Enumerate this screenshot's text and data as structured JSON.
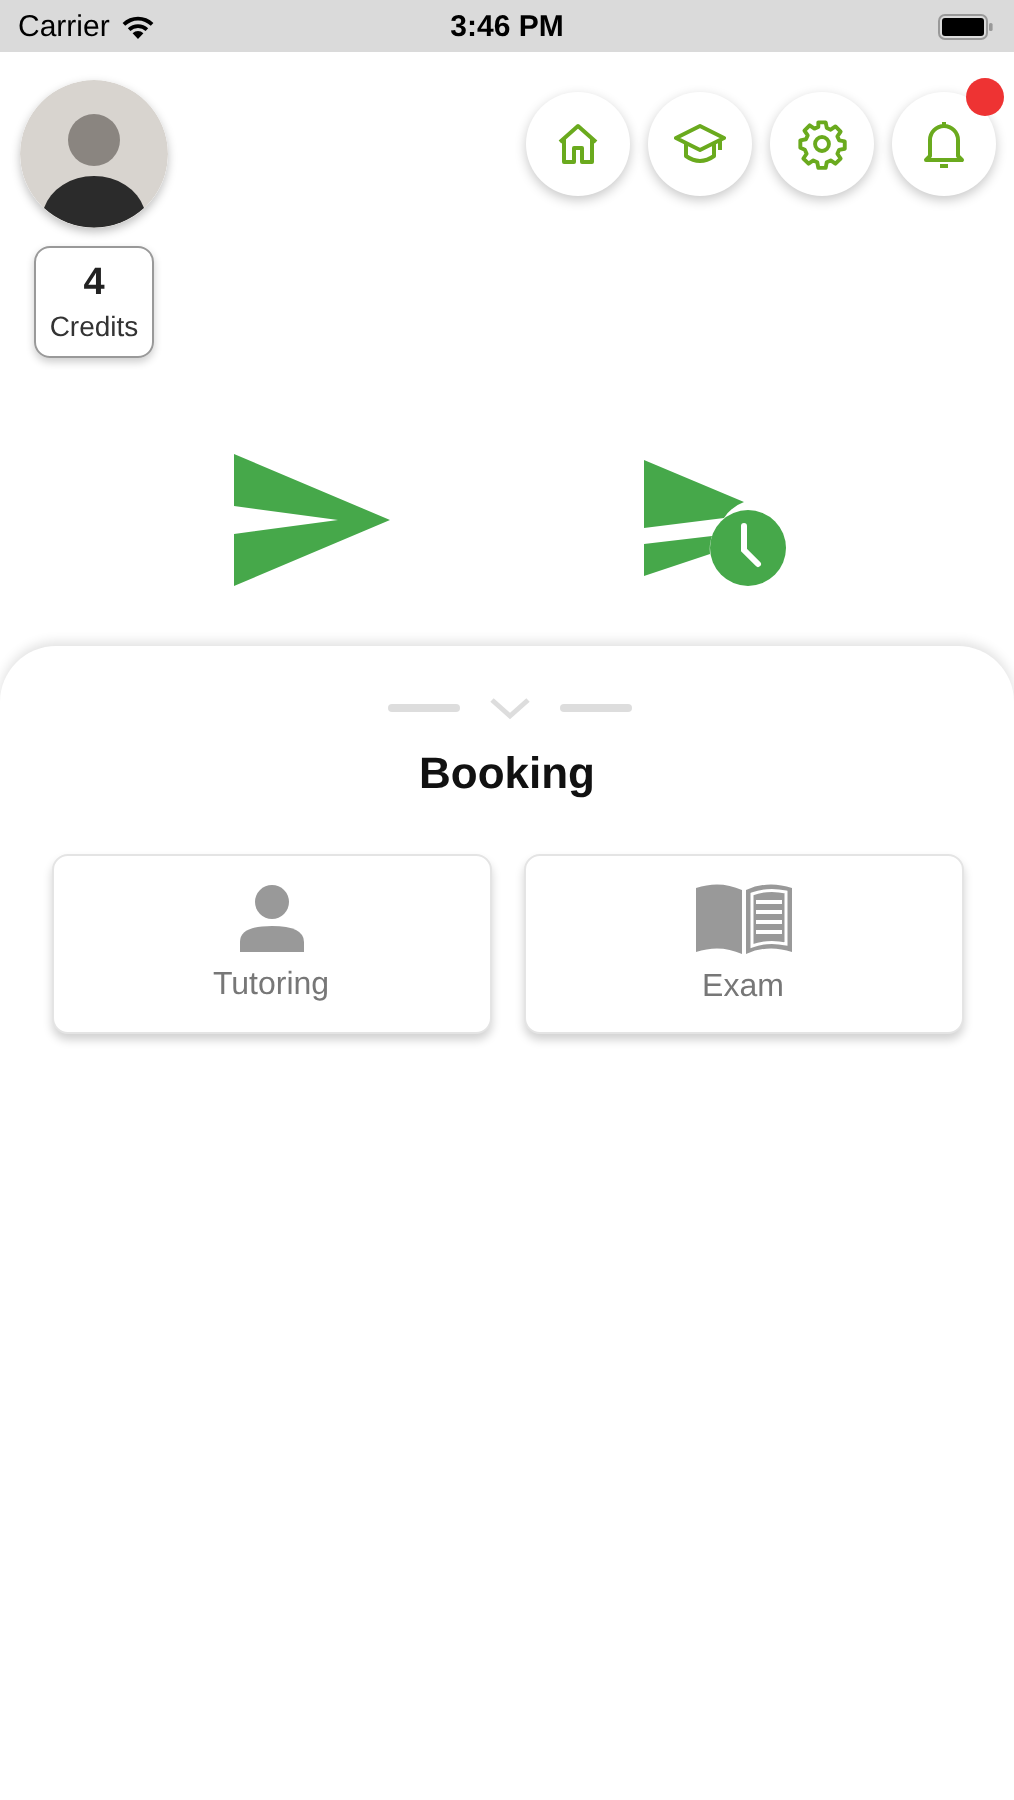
{
  "status_bar": {
    "carrier": "Carrier",
    "time": "3:46 PM"
  },
  "profile": {
    "credits_count": "4",
    "credits_label": "Credits"
  },
  "nav_buttons": [
    {
      "kind": "home",
      "badge": false
    },
    {
      "kind": "education",
      "badge": false
    },
    {
      "kind": "settings",
      "badge": false
    },
    {
      "kind": "notifications",
      "badge": true
    }
  ],
  "actions": [
    {
      "kind": "send"
    },
    {
      "kind": "schedule"
    }
  ],
  "sheet": {
    "title": "Booking",
    "options": [
      {
        "kind": "person",
        "label": "Tutoring"
      },
      {
        "kind": "book",
        "label": "Exam"
      }
    ]
  }
}
